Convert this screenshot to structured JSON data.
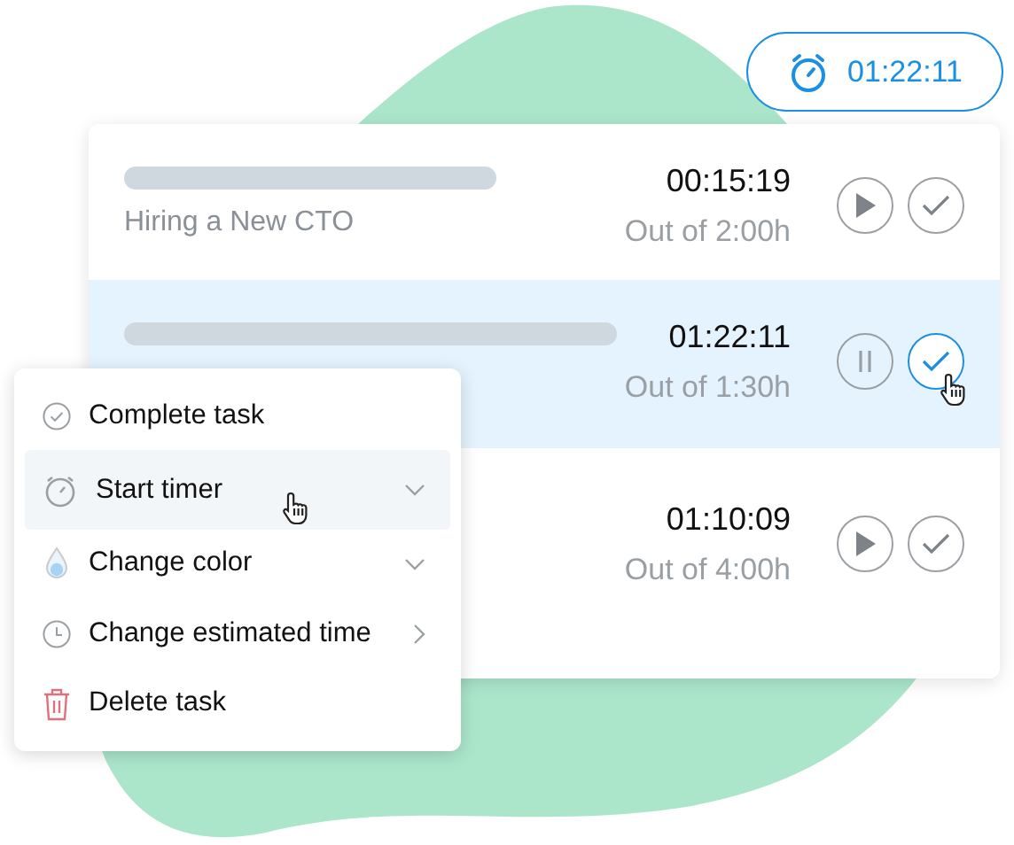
{
  "timer_pill": {
    "time": "01:22:11"
  },
  "tasks": [
    {
      "title_bar": true,
      "subtitle": "Hiring a New CTO",
      "elapsed": "00:15:19",
      "estimate": "Out of 2:00h",
      "running": false,
      "selected": false,
      "check_hovered": false
    },
    {
      "title_bar": true,
      "elapsed": "01:22:11",
      "estimate": "Out of 1:30h",
      "running": true,
      "selected": true,
      "check_hovered": true
    },
    {
      "elapsed": "01:10:09",
      "estimate": "Out of 4:00h",
      "running": false,
      "selected": false,
      "check_hovered": false
    }
  ],
  "context_menu": {
    "items": [
      {
        "kind": "complete",
        "label": "Complete task",
        "selected": false,
        "dropdown": false,
        "submenu": false
      },
      {
        "kind": "timer",
        "label": "Start timer",
        "selected": true,
        "dropdown": true,
        "submenu": false
      },
      {
        "kind": "color",
        "label": "Change color",
        "selected": false,
        "dropdown": true,
        "submenu": false
      },
      {
        "kind": "time",
        "label": "Change estimated time",
        "selected": false,
        "dropdown": false,
        "submenu": true
      },
      {
        "kind": "delete",
        "label": "Delete task",
        "selected": false,
        "dropdown": false,
        "submenu": false
      }
    ]
  }
}
